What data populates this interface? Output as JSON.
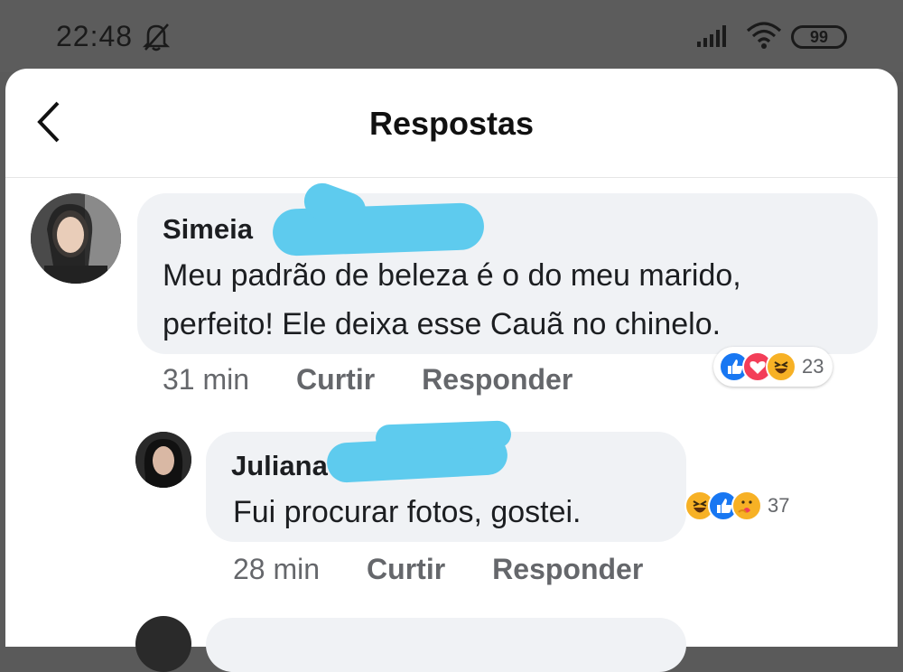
{
  "status_bar": {
    "time": "22:48",
    "battery": "99"
  },
  "header": {
    "title": "Respostas"
  },
  "comments": [
    {
      "author": "Simeia",
      "text_line1": "Meu padrão de beleza é o do meu marido,",
      "text_line2": "perfeito! Ele deixa esse Cauã no chinelo.",
      "time": "31 min",
      "like_label": "Curtir",
      "reply_label": "Responder",
      "reactions": [
        "like-icon",
        "love-icon",
        "haha-icon"
      ],
      "reaction_count": "23"
    },
    {
      "author": "Juliana",
      "text": "Fui procurar fotos, gostei.",
      "time": "28 min",
      "like_label": "Curtir",
      "reply_label": "Responder",
      "reactions": [
        "haha-icon",
        "like-icon",
        "care-icon"
      ],
      "reaction_count": "37"
    }
  ],
  "colors": {
    "like": "#1877f2",
    "love": "#f33e58",
    "haha": "#f7b125",
    "redaction": "#5ecbee"
  }
}
